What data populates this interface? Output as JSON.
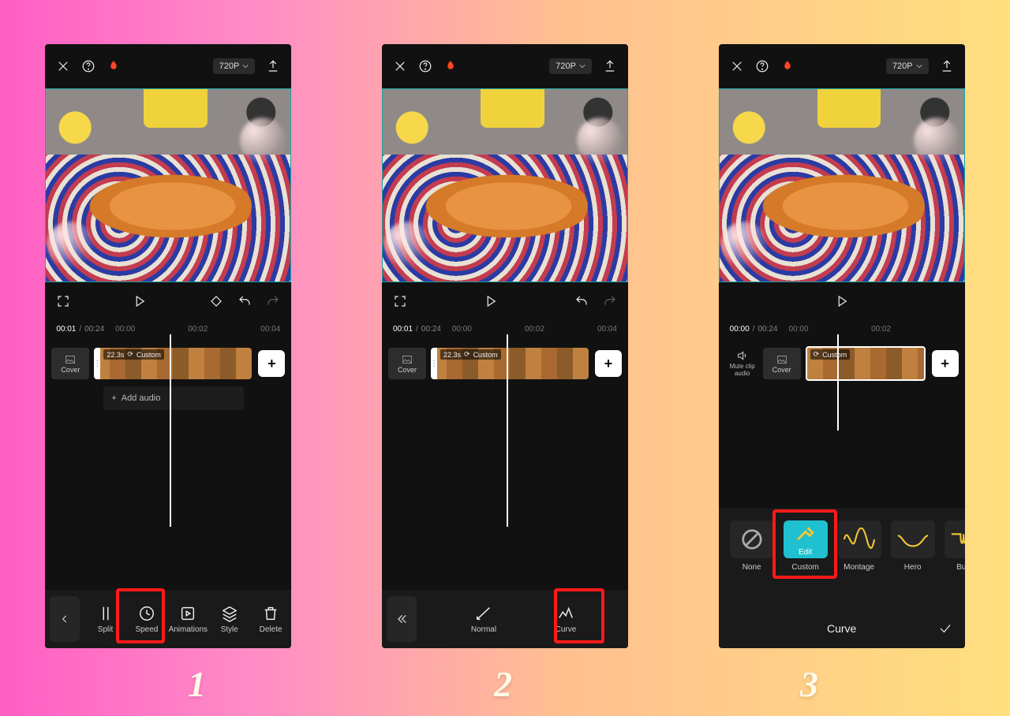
{
  "step_labels": [
    "1",
    "2",
    "3"
  ],
  "topbar": {
    "resolution": "720P"
  },
  "playback": {
    "current": "00:01",
    "total": "00:24",
    "ticks": [
      "00:00",
      "00:02",
      "00:04"
    ]
  },
  "playback3": {
    "current": "00:00",
    "total": "00:24",
    "ticks": [
      "00:00",
      "00:02"
    ]
  },
  "clip": {
    "duration": "22.3s",
    "speed_label": "Custom"
  },
  "timeline": {
    "cover_label": "Cover",
    "add_audio": "Add audio",
    "mute_clip": "Mute clip audio"
  },
  "toolbar1": {
    "items": [
      "Split",
      "Speed",
      "Animations",
      "Style",
      "Delete"
    ]
  },
  "toolbar2": {
    "items": [
      "Normal",
      "Curve"
    ]
  },
  "curve": {
    "presets": [
      "None",
      "Custom",
      "Montage",
      "Hero",
      "Bullet"
    ],
    "edit_label": "Edit",
    "footer": "Curve"
  }
}
